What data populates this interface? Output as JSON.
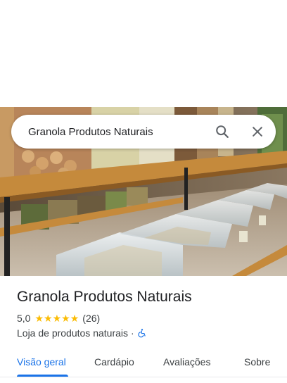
{
  "search": {
    "query": "Granola Produtos Naturais",
    "search_icon": "search-icon",
    "close_icon": "close-icon"
  },
  "hero": {
    "image": "store-interior-photo"
  },
  "place": {
    "name": "Granola Produtos Naturais",
    "rating": "5,0",
    "stars": 5,
    "review_count": "(26)",
    "category": "Loja de produtos naturais",
    "separator": "·",
    "accessibility_icon": "wheelchair-icon"
  },
  "tabs": [
    {
      "label": "Visão geral",
      "active": true
    },
    {
      "label": "Cardápio",
      "active": false
    },
    {
      "label": "Avaliações",
      "active": false
    },
    {
      "label": "Sobre",
      "active": false
    }
  ],
  "colors": {
    "accent": "#1a73e8",
    "star": "#fbbc04",
    "text": "#202124",
    "secondary_text": "#3c4043",
    "accessibility": "#1a73e8"
  }
}
